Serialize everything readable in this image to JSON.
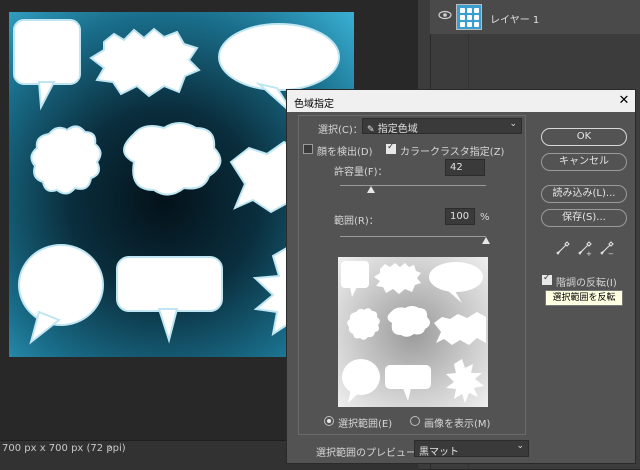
{
  "status": {
    "doc_info": "700 px x 700 px (72 ppi)",
    "chevron": "›"
  },
  "layers": {
    "layer_name": "レイヤー 1"
  },
  "dialog": {
    "title": "色域指定",
    "close": "✕",
    "select_label": "選択(C)：",
    "select_value": "指定色域",
    "detect_faces_label": "顔を検出(D)",
    "localized_clusters_label": "カラークラスタ指定(Z)",
    "fuzziness_label": "許容量(F)：",
    "fuzziness_value": "42",
    "fuzziness_fraction": 0.21,
    "range_label": "範囲(R)：",
    "range_value": "100",
    "range_unit": "%",
    "range_fraction": 1.0,
    "radio_selection": "選択範囲(E)",
    "radio_image": "画像を表示(M)",
    "preview_label": "選択範囲のプレビュー：",
    "preview_value": "黒マット",
    "buttons": {
      "ok": "OK",
      "cancel": "キャンセル",
      "load": "読み込み(L)...",
      "save": "保存(S)..."
    },
    "invert_label": "階調の反転(I)",
    "tooltip": "選択範囲を反転"
  },
  "colors": {
    "accent": "#3ab0d4",
    "dialog_bg": "#535353",
    "title_bar": "#f0f0f0"
  }
}
